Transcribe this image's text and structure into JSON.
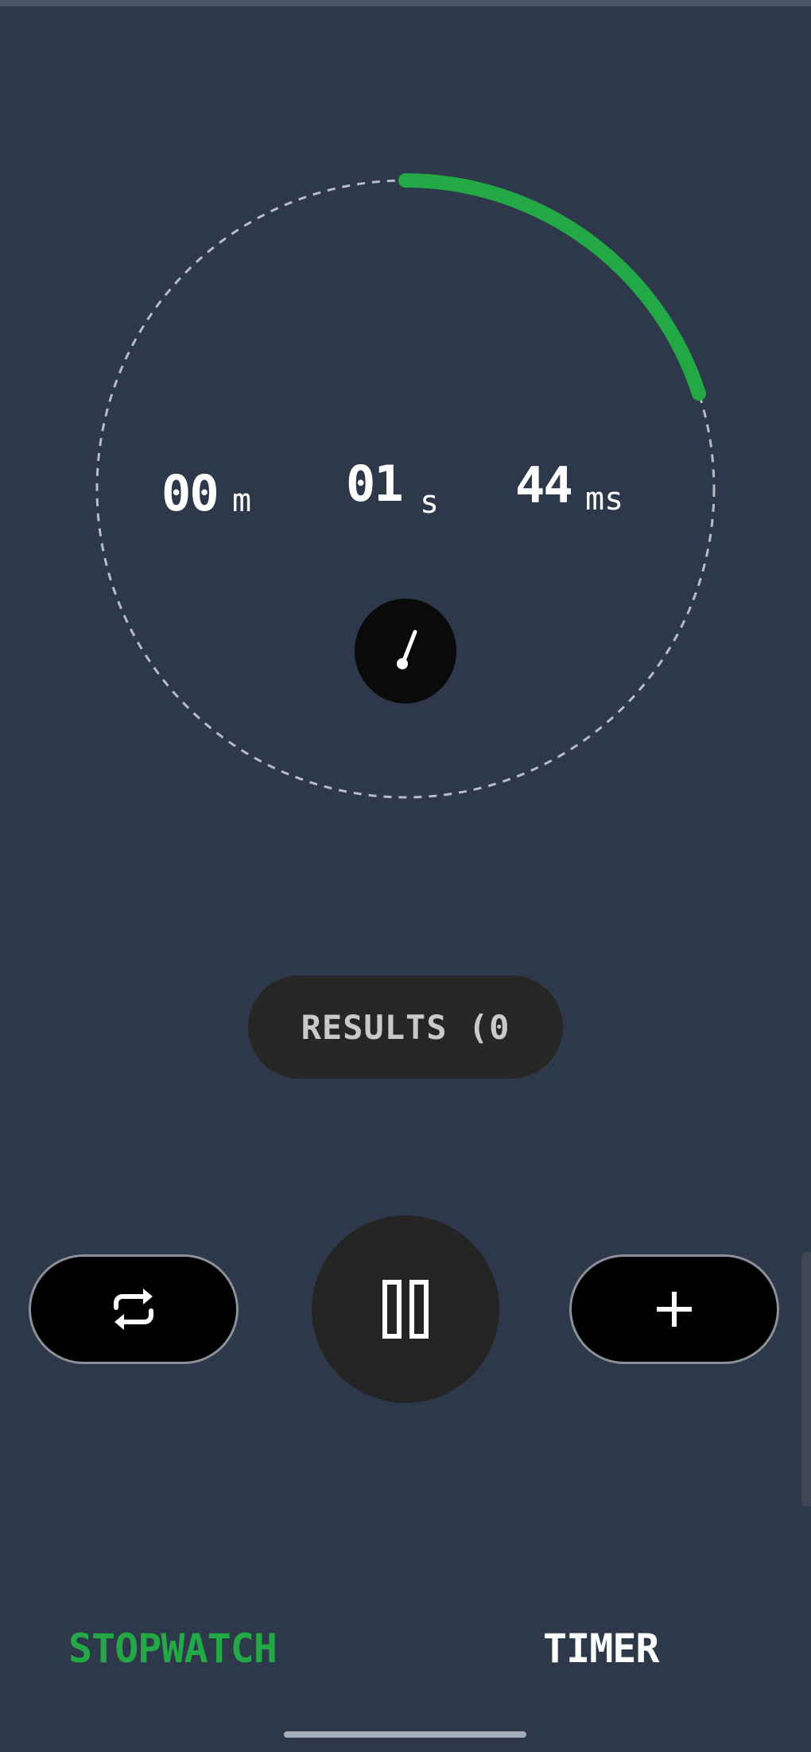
{
  "stopwatch": {
    "minutes": "00",
    "minutes_unit": "m",
    "seconds": "01",
    "seconds_unit": "s",
    "milliseconds": "44",
    "milliseconds_unit": "ms",
    "progress_fraction": 0.2,
    "progress_color": "#22a845"
  },
  "results_button": {
    "label": "RESULTS (0"
  },
  "controls": {
    "reset_icon": "repeat-icon",
    "play_pause_icon": "pause-icon",
    "add_icon": "plus-icon"
  },
  "tabs": [
    {
      "label": "STOPWATCH",
      "active": true,
      "color": "#22a845"
    },
    {
      "label": "TIMER",
      "active": false,
      "color": "#ffffff"
    }
  ],
  "colors": {
    "background": "#2d384a",
    "accent": "#22a845"
  }
}
